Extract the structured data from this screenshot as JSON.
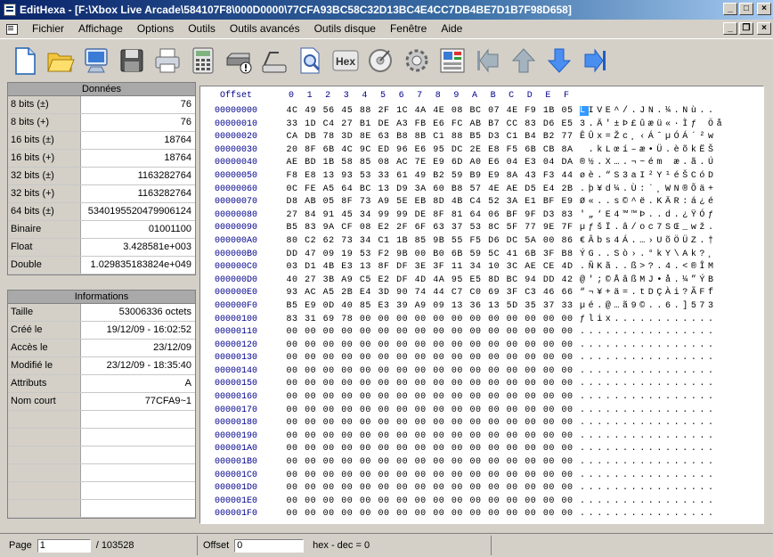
{
  "window": {
    "title": "EditHexa - [F:\\Xbox Live Arcade\\584107F8\\000D0000\\77CFA93BC58C32D13BC4E4CC7DB4BE7D1B7F98D658]",
    "btn_min": "_",
    "btn_max": "□",
    "btn_close": "×"
  },
  "menu": [
    "Fichier",
    "Affichage",
    "Options",
    "Outils",
    "Outils avancés",
    "Outils disque",
    "Fenêtre",
    "Aide"
  ],
  "toolbar": [
    "new-file",
    "open-folder",
    "computer",
    "save-disk",
    "print",
    "calculator",
    "disk-drive",
    "scanner",
    "find-document",
    "hex",
    "disc-scan",
    "settings-gear",
    "image-editor",
    "go-first",
    "go-up",
    "go-down",
    "go-last"
  ],
  "hex_icon_text": "Hex",
  "data_panel": {
    "header": "Données",
    "rows": [
      {
        "k": "8 bits (±)",
        "v": "76"
      },
      {
        "k": "8 bits (+)",
        "v": "76"
      },
      {
        "k": "16 bits (±)",
        "v": "18764"
      },
      {
        "k": "16 bits (+)",
        "v": "18764"
      },
      {
        "k": "32 bits (±)",
        "v": "1163282764"
      },
      {
        "k": "32 bits (+)",
        "v": "1163282764"
      },
      {
        "k": "64 bits (±)",
        "v": "5340195520479906124"
      },
      {
        "k": "Binaire",
        "v": "01001100"
      },
      {
        "k": "Float",
        "v": "3.428581e+003"
      },
      {
        "k": "Double",
        "v": "1.029835183824e+049"
      }
    ]
  },
  "info_panel": {
    "header": "Informations",
    "rows": [
      {
        "k": "Taille",
        "v": "53006336 octets"
      },
      {
        "k": "Créé le",
        "v": "19/12/09 - 16:02:52"
      },
      {
        "k": "Accès le",
        "v": "23/12/09"
      },
      {
        "k": "Modifié le",
        "v": "23/12/09 - 18:35:40"
      },
      {
        "k": "Attributs",
        "v": "A"
      },
      {
        "k": "Nom court",
        "v": "77CFA9~1"
      }
    ]
  },
  "hex": {
    "offset_label": "Offset",
    "columns": [
      "0",
      "1",
      "2",
      "3",
      "4",
      "5",
      "6",
      "7",
      "8",
      "9",
      "A",
      "B",
      "C",
      "D",
      "E",
      "F"
    ],
    "rows": [
      {
        "a": "00000000",
        "b": "4C 49 56 45 88 2F 1C 4A 4E 08 BC 07 4E F9 1B 05",
        "c": "LIVE^/.JN.¼.Nù.."
      },
      {
        "a": "00000010",
        "b": "33 1D C4 27 B1 DE A3 FB E6 FC AB B7 CC 83 D6 E5",
        "c": "3.Ä'±Þ£ûæü«·Ìƒ Öå"
      },
      {
        "a": "00000020",
        "b": "CA DB 78 3D 8E 63 B8 8B C1 88 B5 D3 C1 B4 B2 77",
        "c": "ÊÛx=Žc¸‹ÁˆµÓÁ´²w"
      },
      {
        "a": "00000030",
        "b": "20 8F 6B 4C 9C ED 96 E6 95 DC 2E E8 F5 6B CB 8A",
        "c": " .kLœí–æ•Ü.èõkËŠ"
      },
      {
        "a": "00000040",
        "b": "AE BD 1B 58 85 08 AC 7E E9 6D A0 E6 04 E3 04 DA",
        "c": "®½.X….¬~ém æ.ã.Ú"
      },
      {
        "a": "00000050",
        "b": "F8 E8 13 93 53 33 61 49 B2 59 B9 E9 8A 43 F3 44",
        "c": "øè.“S3aI²Y¹éŠCóD"
      },
      {
        "a": "00000060",
        "b": "0C FE A5 64 BC 13 D9 3A 60 B8 57 4E AE D5 E4 2B",
        "c": ".þ¥d¼.Ù:`¸WN®Õä+"
      },
      {
        "a": "00000070",
        "b": "D8 AB 05 8F 73 A9 5E EB 8D 4B C4 52 3A E1 BF E9",
        "c": "Ø«..s©^ë.KÄR:á¿é"
      },
      {
        "a": "00000080",
        "b": "27 84 91 45 34 99 99 DE 8F 81 64 06 BF 9F D3 83",
        "c": "'„‘E4™™Þ..d.¿ŸÓƒ"
      },
      {
        "a": "00000090",
        "b": "B5 83 9A CF 08 E2 2F 6F 63 37 53 8C 5F 77 9E 7F",
        "c": "µƒšÏ.â/oc7SŒ_wž."
      },
      {
        "a": "000000A0",
        "b": "80 C2 62 73 34 C1 1B 85 9B 55 F5 D6 DC 5A 00 86",
        "c": "€Âbs4Á.…›UõÖÜZ.†"
      },
      {
        "a": "000000B0",
        "b": "DD 47 09 19 53 F2 9B 00 B0 6B 59 5C 41 6B 3F B8",
        "c": "ÝG..Sò›.°kY\\Ak?¸"
      },
      {
        "a": "000000C0",
        "b": "03 D1 4B E3 13 8F DF 3E 3F 11 34 10 3C AE CE 4D",
        "c": ".ÑKã..ß>?.4.<®ÎM"
      },
      {
        "a": "000000D0",
        "b": "40 27 3B A9 C5 E2 DF 4D 4A 95 E5 8D BC 94 DD 42",
        "c": "@';©ÅâßMJ•å.¼”ÝB"
      },
      {
        "a": "000000E0",
        "b": "93 AC A5 2B E4 3D 90 74 44 C7 C0 69 3F C3 46 66",
        "c": "“¬¥+ä=.tDÇÀi?ÃFf"
      },
      {
        "a": "000000F0",
        "b": "B5 E9 0D 40 85 E3 39 A9 09 13 36 13 5D 35 37 33",
        "c": "µé.@…ã9©..6.]573"
      },
      {
        "a": "00000100",
        "b": "83 31 69 78 00 00 00 00 00 00 00 00 00 00 00 00",
        "c": "ƒlix............"
      },
      {
        "a": "00000110",
        "b": "00 00 00 00 00 00 00 00 00 00 00 00 00 00 00 00",
        "c": "................"
      },
      {
        "a": "00000120",
        "b": "00 00 00 00 00 00 00 00 00 00 00 00 00 00 00 00",
        "c": "................"
      },
      {
        "a": "00000130",
        "b": "00 00 00 00 00 00 00 00 00 00 00 00 00 00 00 00",
        "c": "................"
      },
      {
        "a": "00000140",
        "b": "00 00 00 00 00 00 00 00 00 00 00 00 00 00 00 00",
        "c": "................"
      },
      {
        "a": "00000150",
        "b": "00 00 00 00 00 00 00 00 00 00 00 00 00 00 00 00",
        "c": "................"
      },
      {
        "a": "00000160",
        "b": "00 00 00 00 00 00 00 00 00 00 00 00 00 00 00 00",
        "c": "................"
      },
      {
        "a": "00000170",
        "b": "00 00 00 00 00 00 00 00 00 00 00 00 00 00 00 00",
        "c": "................"
      },
      {
        "a": "00000180",
        "b": "00 00 00 00 00 00 00 00 00 00 00 00 00 00 00 00",
        "c": "................"
      },
      {
        "a": "00000190",
        "b": "00 00 00 00 00 00 00 00 00 00 00 00 00 00 00 00",
        "c": "................"
      },
      {
        "a": "000001A0",
        "b": "00 00 00 00 00 00 00 00 00 00 00 00 00 00 00 00",
        "c": "................"
      },
      {
        "a": "000001B0",
        "b": "00 00 00 00 00 00 00 00 00 00 00 00 00 00 00 00",
        "c": "................"
      },
      {
        "a": "000001C0",
        "b": "00 00 00 00 00 00 00 00 00 00 00 00 00 00 00 00",
        "c": "................"
      },
      {
        "a": "000001D0",
        "b": "00 00 00 00 00 00 00 00 00 00 00 00 00 00 00 00",
        "c": "................"
      },
      {
        "a": "000001E0",
        "b": "00 00 00 00 00 00 00 00 00 00 00 00 00 00 00 00",
        "c": "................"
      },
      {
        "a": "000001F0",
        "b": "00 00 00 00 00 00 00 00 00 00 00 00 00 00 00 00",
        "c": "................"
      }
    ]
  },
  "status": {
    "page_label": "Page",
    "page_value": "1",
    "page_total": "/ 103528",
    "offset_label": "Offset",
    "offset_value": "0",
    "hexdec": "hex - dec = 0"
  }
}
